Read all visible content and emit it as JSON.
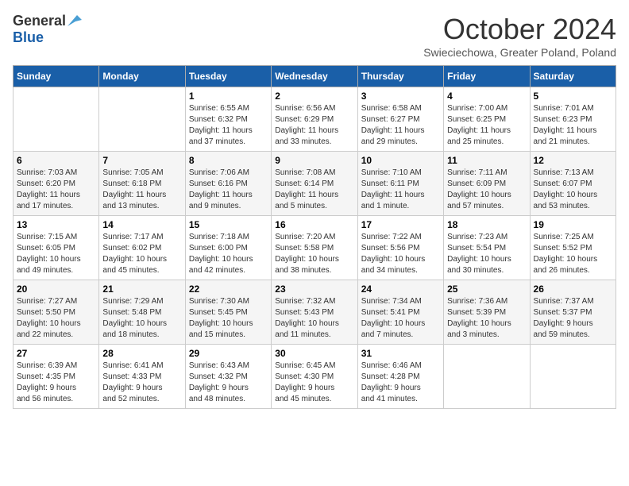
{
  "header": {
    "logo_general": "General",
    "logo_blue": "Blue",
    "title": "October 2024",
    "subtitle": "Swieciechowa, Greater Poland, Poland"
  },
  "weekdays": [
    "Sunday",
    "Monday",
    "Tuesday",
    "Wednesday",
    "Thursday",
    "Friday",
    "Saturday"
  ],
  "weeks": [
    [
      {
        "day": "",
        "info": ""
      },
      {
        "day": "",
        "info": ""
      },
      {
        "day": "1",
        "info": "Sunrise: 6:55 AM\nSunset: 6:32 PM\nDaylight: 11 hours\nand 37 minutes."
      },
      {
        "day": "2",
        "info": "Sunrise: 6:56 AM\nSunset: 6:29 PM\nDaylight: 11 hours\nand 33 minutes."
      },
      {
        "day": "3",
        "info": "Sunrise: 6:58 AM\nSunset: 6:27 PM\nDaylight: 11 hours\nand 29 minutes."
      },
      {
        "day": "4",
        "info": "Sunrise: 7:00 AM\nSunset: 6:25 PM\nDaylight: 11 hours\nand 25 minutes."
      },
      {
        "day": "5",
        "info": "Sunrise: 7:01 AM\nSunset: 6:23 PM\nDaylight: 11 hours\nand 21 minutes."
      }
    ],
    [
      {
        "day": "6",
        "info": "Sunrise: 7:03 AM\nSunset: 6:20 PM\nDaylight: 11 hours\nand 17 minutes."
      },
      {
        "day": "7",
        "info": "Sunrise: 7:05 AM\nSunset: 6:18 PM\nDaylight: 11 hours\nand 13 minutes."
      },
      {
        "day": "8",
        "info": "Sunrise: 7:06 AM\nSunset: 6:16 PM\nDaylight: 11 hours\nand 9 minutes."
      },
      {
        "day": "9",
        "info": "Sunrise: 7:08 AM\nSunset: 6:14 PM\nDaylight: 11 hours\nand 5 minutes."
      },
      {
        "day": "10",
        "info": "Sunrise: 7:10 AM\nSunset: 6:11 PM\nDaylight: 11 hours\nand 1 minute."
      },
      {
        "day": "11",
        "info": "Sunrise: 7:11 AM\nSunset: 6:09 PM\nDaylight: 10 hours\nand 57 minutes."
      },
      {
        "day": "12",
        "info": "Sunrise: 7:13 AM\nSunset: 6:07 PM\nDaylight: 10 hours\nand 53 minutes."
      }
    ],
    [
      {
        "day": "13",
        "info": "Sunrise: 7:15 AM\nSunset: 6:05 PM\nDaylight: 10 hours\nand 49 minutes."
      },
      {
        "day": "14",
        "info": "Sunrise: 7:17 AM\nSunset: 6:02 PM\nDaylight: 10 hours\nand 45 minutes."
      },
      {
        "day": "15",
        "info": "Sunrise: 7:18 AM\nSunset: 6:00 PM\nDaylight: 10 hours\nand 42 minutes."
      },
      {
        "day": "16",
        "info": "Sunrise: 7:20 AM\nSunset: 5:58 PM\nDaylight: 10 hours\nand 38 minutes."
      },
      {
        "day": "17",
        "info": "Sunrise: 7:22 AM\nSunset: 5:56 PM\nDaylight: 10 hours\nand 34 minutes."
      },
      {
        "day": "18",
        "info": "Sunrise: 7:23 AM\nSunset: 5:54 PM\nDaylight: 10 hours\nand 30 minutes."
      },
      {
        "day": "19",
        "info": "Sunrise: 7:25 AM\nSunset: 5:52 PM\nDaylight: 10 hours\nand 26 minutes."
      }
    ],
    [
      {
        "day": "20",
        "info": "Sunrise: 7:27 AM\nSunset: 5:50 PM\nDaylight: 10 hours\nand 22 minutes."
      },
      {
        "day": "21",
        "info": "Sunrise: 7:29 AM\nSunset: 5:48 PM\nDaylight: 10 hours\nand 18 minutes."
      },
      {
        "day": "22",
        "info": "Sunrise: 7:30 AM\nSunset: 5:45 PM\nDaylight: 10 hours\nand 15 minutes."
      },
      {
        "day": "23",
        "info": "Sunrise: 7:32 AM\nSunset: 5:43 PM\nDaylight: 10 hours\nand 11 minutes."
      },
      {
        "day": "24",
        "info": "Sunrise: 7:34 AM\nSunset: 5:41 PM\nDaylight: 10 hours\nand 7 minutes."
      },
      {
        "day": "25",
        "info": "Sunrise: 7:36 AM\nSunset: 5:39 PM\nDaylight: 10 hours\nand 3 minutes."
      },
      {
        "day": "26",
        "info": "Sunrise: 7:37 AM\nSunset: 5:37 PM\nDaylight: 9 hours\nand 59 minutes."
      }
    ],
    [
      {
        "day": "27",
        "info": "Sunrise: 6:39 AM\nSunset: 4:35 PM\nDaylight: 9 hours\nand 56 minutes."
      },
      {
        "day": "28",
        "info": "Sunrise: 6:41 AM\nSunset: 4:33 PM\nDaylight: 9 hours\nand 52 minutes."
      },
      {
        "day": "29",
        "info": "Sunrise: 6:43 AM\nSunset: 4:32 PM\nDaylight: 9 hours\nand 48 minutes."
      },
      {
        "day": "30",
        "info": "Sunrise: 6:45 AM\nSunset: 4:30 PM\nDaylight: 9 hours\nand 45 minutes."
      },
      {
        "day": "31",
        "info": "Sunrise: 6:46 AM\nSunset: 4:28 PM\nDaylight: 9 hours\nand 41 minutes."
      },
      {
        "day": "",
        "info": ""
      },
      {
        "day": "",
        "info": ""
      }
    ]
  ]
}
